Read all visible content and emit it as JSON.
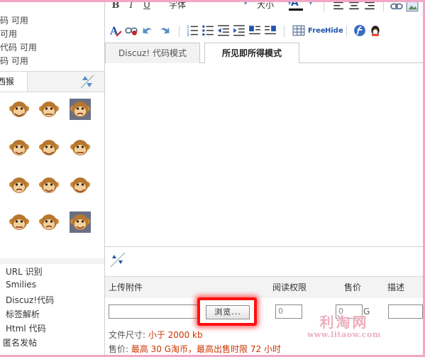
{
  "permissions": [
    {
      "text": "码 可用"
    },
    {
      "text": "可用"
    },
    {
      "text": "代码 可用"
    },
    {
      "text": "码 可用"
    }
  ],
  "smilies": {
    "tab_label": "西猴",
    "icons": [
      "monkey-laugh-icon",
      "monkey-squint-icon",
      "monkey-shock-icon",
      "monkey-love-icon",
      "monkey-eat-icon",
      "monkey-dizzy-icon",
      "monkey-sleepy-icon",
      "monkey-hmm-icon",
      "monkey-hide-icon",
      "monkey-cry-icon",
      "monkey-angry-icon",
      "monkey-dark-icon"
    ]
  },
  "options": [
    {
      "text": "URL 识别"
    },
    {
      "text": "Smilies"
    },
    {
      "text": "Discuz!代码"
    },
    {
      "text": "标签解析"
    },
    {
      "text": "Html 代码"
    },
    {
      "text": "匿名发帖"
    },
    {
      "text": "..."
    }
  ],
  "toolbar": {
    "bold": "B",
    "italic": "I",
    "underline": "U",
    "font_label": "字体",
    "size_label": "大小",
    "color_letter": "A",
    "free_label": "Free",
    "hide_label": "Hide"
  },
  "tabs": {
    "code_mode": "Discuz! 代码模式",
    "wysiwyg_mode": "所见即所得模式"
  },
  "attachments": {
    "col_upload": "上传附件",
    "col_permission": "阅读权限",
    "col_price": "售价",
    "col_desc": "描述",
    "browse_label": "浏览...",
    "permission_value": "0",
    "price_value": "0",
    "price_unit": "G"
  },
  "info": {
    "size_prefix": "文件尺寸: ",
    "size_value": "小于  2000 kb",
    "price_prefix": "售价: ",
    "price_value": "最高  30 G淘币，最高出售时限  72 小时"
  },
  "watermark": {
    "title": "利淘网",
    "url": "www.litaow.com"
  },
  "colors": {
    "accent_red": "#ff1010",
    "highlight_text": "#cc3300",
    "frame_pink": "#f1a7c6"
  }
}
